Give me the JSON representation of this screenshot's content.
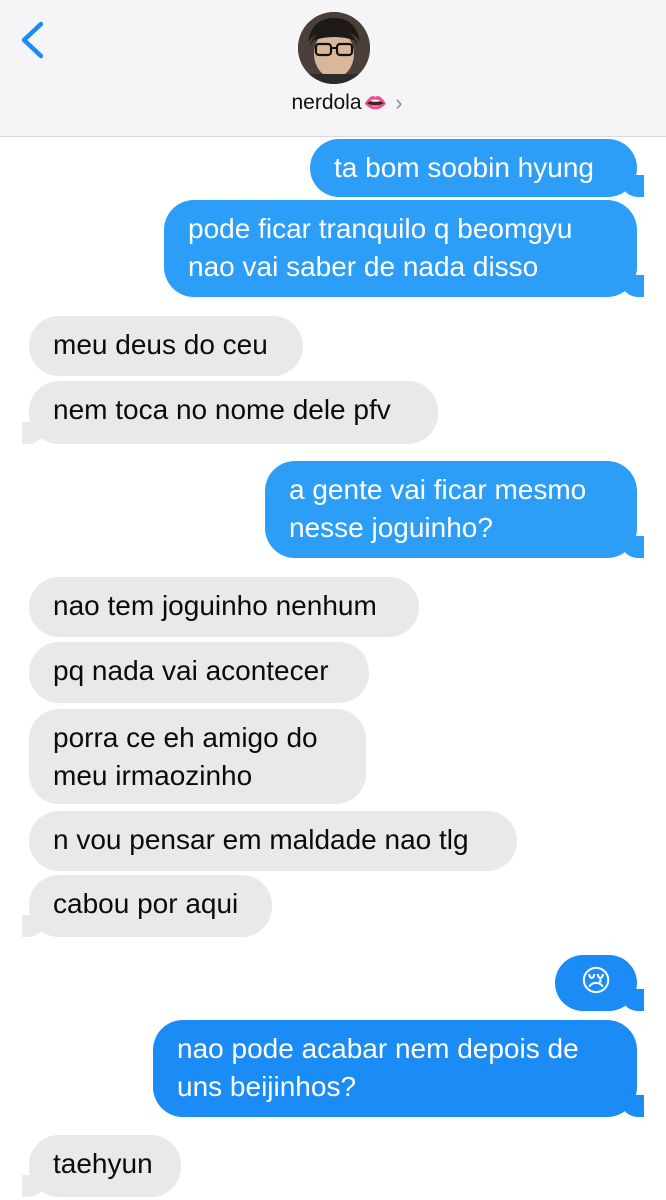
{
  "header": {
    "contact_name": "nerdola",
    "contact_emoji": "👄",
    "back_icon": "chevron-left-icon",
    "details_icon": "chevron-right-icon",
    "accent": "#1b8cf6"
  },
  "messages": [
    {
      "from": "me",
      "text": "ta bom soobin hyung"
    },
    {
      "from": "me",
      "text": "pode ficar tranquilo q beomgyu\nnao vai saber de nada disso"
    },
    {
      "from": "them",
      "text": "meu deus do ceu"
    },
    {
      "from": "them",
      "text": "nem toca no nome dele pfv"
    },
    {
      "from": "me",
      "text": "a gente vai ficar mesmo\nnesse joguinho?"
    },
    {
      "from": "them",
      "text": "nao tem joguinho nenhum"
    },
    {
      "from": "them",
      "text": "pq nada vai acontecer"
    },
    {
      "from": "them",
      "text": "porra ce eh amigo do\nmeu irmaozinho"
    },
    {
      "from": "them",
      "text": "n vou pensar em maldade nao tlg"
    },
    {
      "from": "them",
      "text": "cabou por aqui"
    },
    {
      "from": "me",
      "text": "😢"
    },
    {
      "from": "me",
      "text": "nao pode acabar nem depois de\nuns beijinhos?"
    },
    {
      "from": "them",
      "text": "taehyun"
    }
  ]
}
